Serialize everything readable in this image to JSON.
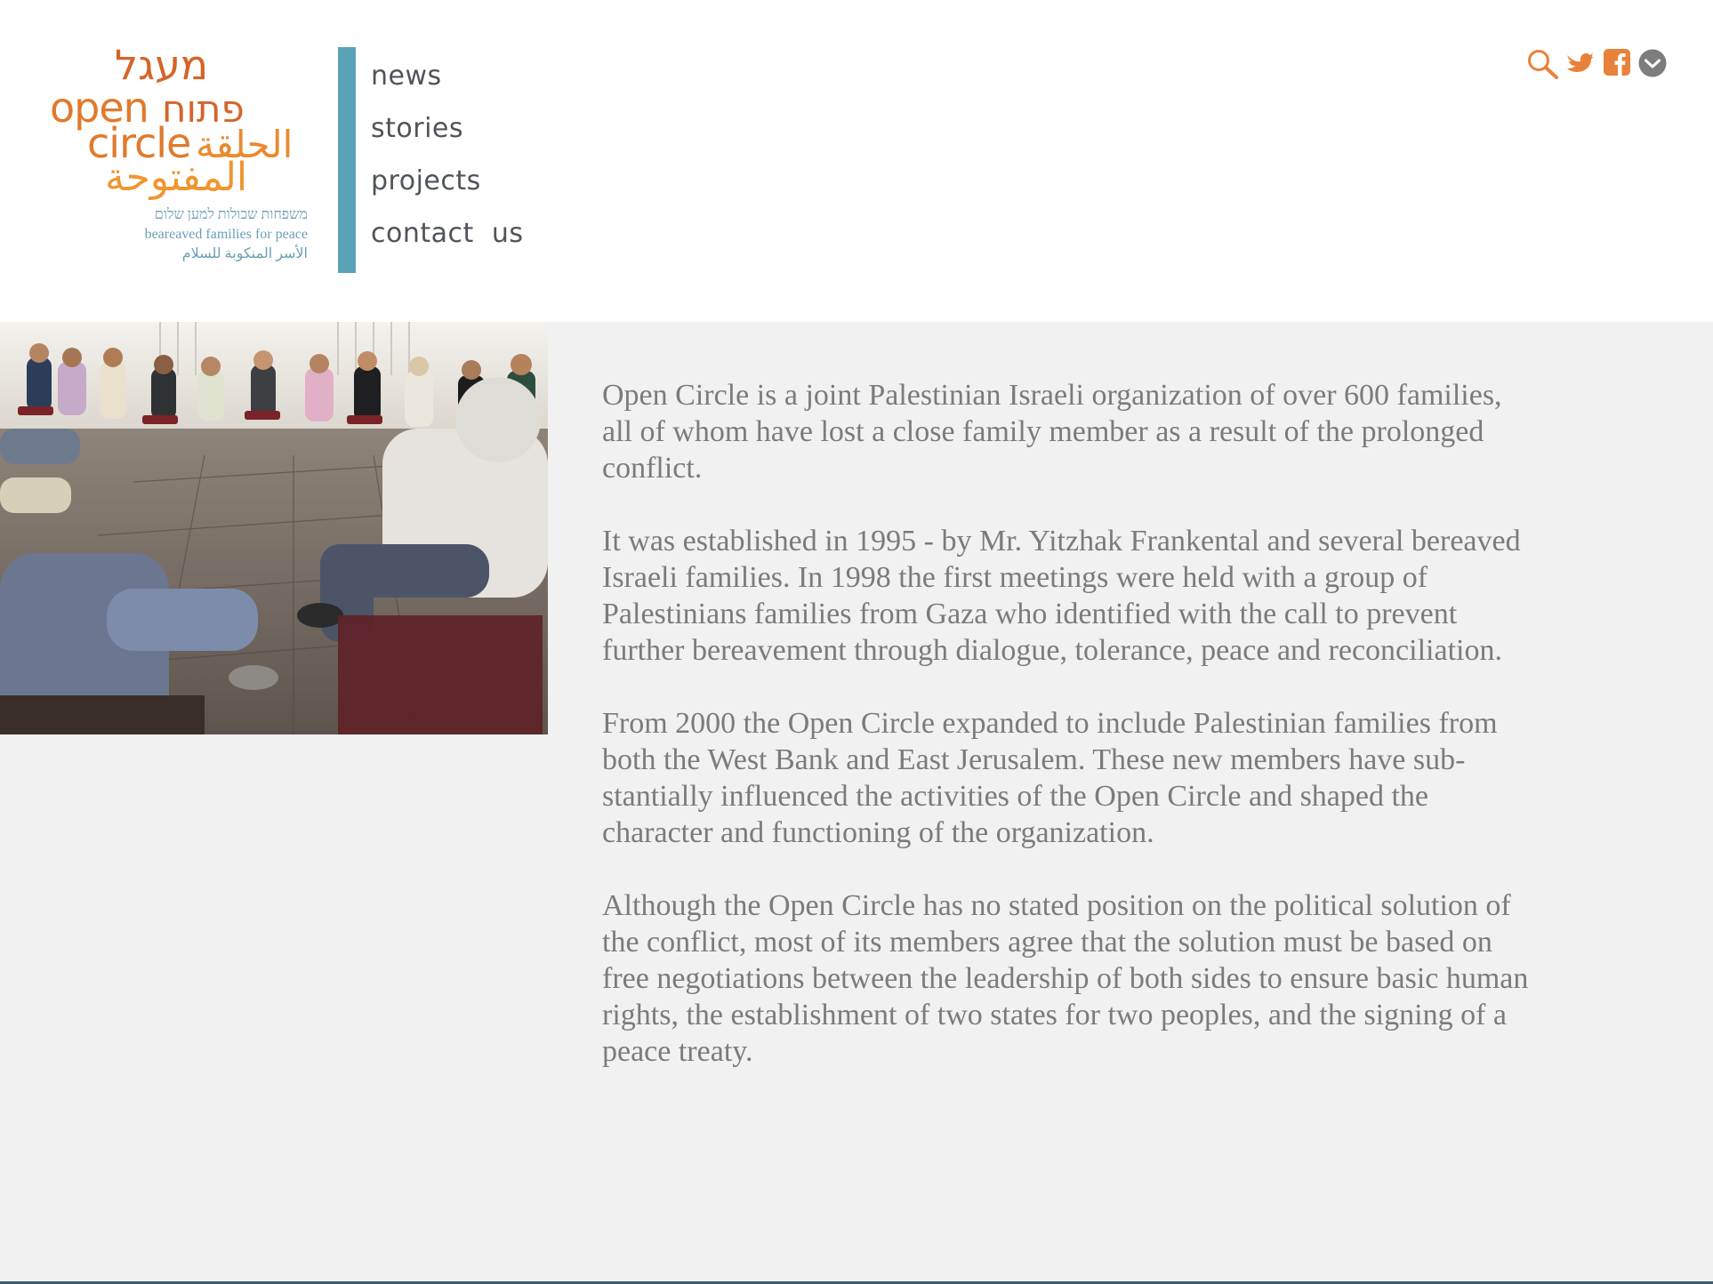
{
  "logo": {
    "hebrew_top": "מעגל",
    "english_open": "open",
    "hebrew_mid": "פתוח",
    "english_circle": "circle",
    "arabic_mid": "الحلقة",
    "arabic_bottom": "المفتوحة",
    "tagline_hebrew": "משפחות שכולות למען שלום",
    "tagline_english": "beareaved families for peace",
    "tagline_arabic": "الأسر المنكوبة للسلام"
  },
  "nav": {
    "items": [
      {
        "label": "news"
      },
      {
        "label": "stories"
      },
      {
        "label": "projects"
      },
      {
        "label": "contact  us"
      }
    ]
  },
  "social": {
    "icons": [
      "search-icon",
      "twitter-icon",
      "facebook-icon",
      "chevron-down-icon"
    ],
    "accent": "#e8823a",
    "gray": "#7d7d7d"
  },
  "colors": {
    "nav_bar": "#5aa3b6",
    "text": "#7b7b7b",
    "main_bg": "#f1f1f1"
  },
  "content": {
    "paragraphs": [
      "Open Circle is a joint Palestinian Israeli organization of over 600 families, all of whom have lost a close family member as a result of the prolonged conflict.",
      "It was established in 1995 - by Mr. Yitzhak Frankental and several bereaved Israeli families. In 1998 the first meetings were held with a group of Palestinians families from Gaza who identified with the call to prevent further bereavement through dialogue, tolerance, peace and reconciliation.",
      "From 2000 the Open Circle expanded to include Palestinian families from both the West Bank and East Jerusalem. These new members have sub-stantially influenced the activities of the Open Circle and shaped the character and functioning of the organization.",
      "Although the Open Circle has no stated position on the political solution of the conflict, most of its members agree that the solution must be based on free negotiations between the leadership of both sides to ensure basic human rights, the establishment of two states for two peoples, and the signing of a peace treaty."
    ]
  }
}
